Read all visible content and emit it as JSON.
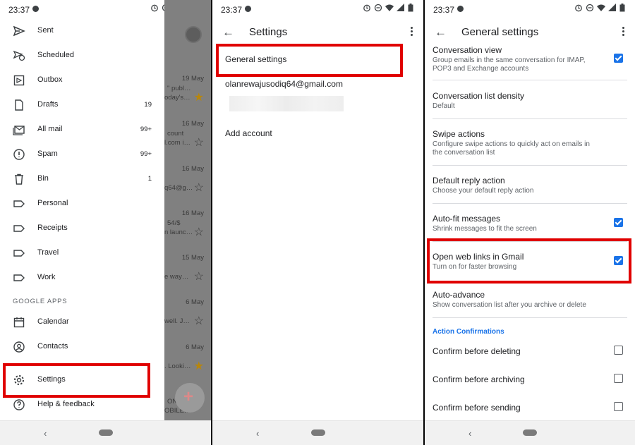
{
  "status": {
    "time": "23:37"
  },
  "drawer": {
    "items": [
      {
        "label": "Sent",
        "count": "",
        "icon": "send-icon"
      },
      {
        "label": "Scheduled",
        "count": "",
        "icon": "schedule-icon"
      },
      {
        "label": "Outbox",
        "count": "",
        "icon": "outbox-icon"
      },
      {
        "label": "Drafts",
        "count": "19",
        "icon": "draft-icon"
      },
      {
        "label": "All mail",
        "count": "99+",
        "icon": "all-mail-icon"
      },
      {
        "label": "Spam",
        "count": "99+",
        "icon": "spam-icon"
      },
      {
        "label": "Bin",
        "count": "1",
        "icon": "bin-icon"
      },
      {
        "label": "Personal",
        "count": "",
        "icon": "label-icon"
      },
      {
        "label": "Receipts",
        "count": "",
        "icon": "label-icon"
      },
      {
        "label": "Travel",
        "count": "",
        "icon": "label-icon"
      },
      {
        "label": "Work",
        "count": "",
        "icon": "label-icon"
      }
    ],
    "section_google_apps": "GOOGLE APPS",
    "apps": [
      {
        "label": "Calendar",
        "icon": "calendar-icon"
      },
      {
        "label": "Contacts",
        "icon": "contacts-icon"
      }
    ],
    "settings_label": "Settings",
    "help_label": "Help & feedback"
  },
  "mail_list": [
    {
      "date": "19 May",
      "t1": "\" publ…",
      "t2": "oday's…",
      "starred": true
    },
    {
      "date": "16 May",
      "t1": "count",
      "t2": "l.com i…",
      "starred": false
    },
    {
      "date": "16 May",
      "t1": "",
      "t2": "q64@g…",
      "starred": false
    },
    {
      "date": "16 May",
      "t1": "54/$",
      "t2": "n launc…",
      "starred": false
    },
    {
      "date": "15 May",
      "t1": "",
      "t2": "e way…",
      "starred": false
    },
    {
      "date": "6 May",
      "t1": "",
      "t2": "well. J…",
      "starred": false
    },
    {
      "date": "6 May",
      "t1": "",
      "t2": ". Looki…",
      "starred": true
    },
    {
      "date": "",
      "t1": "ON",
      "t2": "OBILE…",
      "starred": false
    }
  ],
  "settings_screen": {
    "title": "Settings",
    "general": "General settings",
    "account": "olanrewajusodiq64@gmail.com",
    "add_account": "Add account"
  },
  "general_screen": {
    "title": "General settings",
    "items": [
      {
        "title": "Conversation view",
        "sub": "Group emails in the same conversation for IMAP, POP3 and Exchange accounts",
        "checkbox": "on"
      },
      {
        "title": "Conversation list density",
        "sub": "Default",
        "checkbox": "none"
      },
      {
        "title": "Swipe actions",
        "sub": "Configure swipe actions to quickly act on emails in the conversation list",
        "checkbox": "none"
      },
      {
        "title": "Default reply action",
        "sub": "Choose your default reply action",
        "checkbox": "none"
      },
      {
        "title": "Auto-fit messages",
        "sub": "Shrink messages to fit the screen",
        "checkbox": "on"
      },
      {
        "title": "Open web links in Gmail",
        "sub": "Turn on for faster browsing",
        "checkbox": "on"
      },
      {
        "title": "Auto-advance",
        "sub": "Show conversation list after you archive or delete",
        "checkbox": "none"
      }
    ],
    "section": "Action Confirmations",
    "confirms": [
      {
        "title": "Confirm before deleting",
        "checkbox": "off"
      },
      {
        "title": "Confirm before archiving",
        "checkbox": "off"
      },
      {
        "title": "Confirm before sending",
        "checkbox": "off"
      }
    ]
  },
  "colors": {
    "highlight": "#e00000",
    "accent": "#1a73e8"
  }
}
